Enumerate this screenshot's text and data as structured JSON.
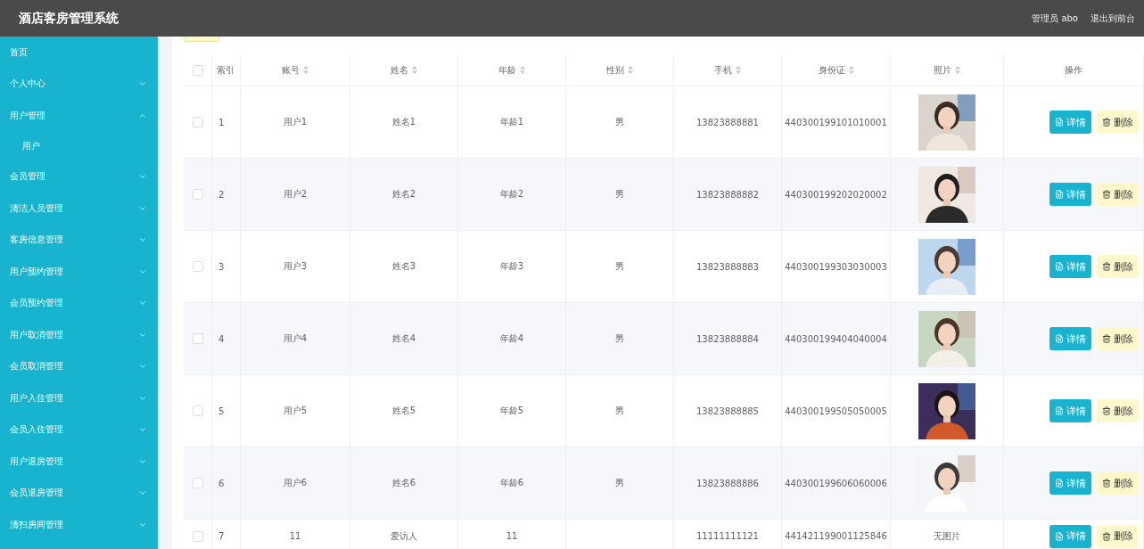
{
  "header": {
    "title": "酒店客房管理系统",
    "user": "管理员 abo",
    "logout": "退出到前台"
  },
  "sidebar": {
    "items": [
      {
        "label": "首页"
      },
      {
        "label": "个人中心",
        "expanded": false
      },
      {
        "label": "用户管理",
        "expanded": true,
        "children": [
          {
            "label": "用户"
          }
        ]
      },
      {
        "label": "会员管理",
        "expanded": false
      },
      {
        "label": "清洁人员管理",
        "expanded": false
      },
      {
        "label": "客房信息管理",
        "expanded": false
      },
      {
        "label": "用户预约管理",
        "expanded": false
      },
      {
        "label": "会员预约管理",
        "expanded": false
      },
      {
        "label": "用户取消管理",
        "expanded": false
      },
      {
        "label": "会员取消管理",
        "expanded": false
      },
      {
        "label": "用户入住管理",
        "expanded": false
      },
      {
        "label": "会员入住管理",
        "expanded": false
      },
      {
        "label": "用户退房管理",
        "expanded": false
      },
      {
        "label": "会员退房管理",
        "expanded": false
      },
      {
        "label": "清扫房间管理",
        "expanded": false
      }
    ]
  },
  "table": {
    "select_all_checked": false,
    "columns": [
      {
        "label": "索引",
        "sortable": false
      },
      {
        "label": "账号",
        "sortable": true
      },
      {
        "label": "姓名",
        "sortable": true
      },
      {
        "label": "年龄",
        "sortable": true
      },
      {
        "label": "性别",
        "sortable": true
      },
      {
        "label": "手机",
        "sortable": true
      },
      {
        "label": "身份证",
        "sortable": true
      },
      {
        "label": "照片",
        "sortable": true
      },
      {
        "label": "操作",
        "sortable": false
      }
    ],
    "rows": [
      {
        "checked": false,
        "index": "1",
        "account": "用户1",
        "name": "姓名1",
        "age": "年龄1",
        "gender": "男",
        "phone": "13823888881",
        "id_card": "440300199101010001",
        "actions": [
          {
            "kind": "detail",
            "label": "详情"
          },
          {
            "kind": "delete",
            "label": "删除"
          }
        ]
      },
      {
        "checked": false,
        "index": "2",
        "account": "用户2",
        "name": "姓名2",
        "age": "年龄2",
        "gender": "男",
        "phone": "13823888882",
        "id_card": "440300199202020002",
        "actions": [
          {
            "kind": "detail",
            "label": "详情"
          },
          {
            "kind": "delete",
            "label": "删除"
          }
        ]
      },
      {
        "checked": false,
        "index": "3",
        "account": "用户3",
        "name": "姓名3",
        "age": "年龄3",
        "gender": "男",
        "phone": "13823888883",
        "id_card": "440300199303030003",
        "actions": [
          {
            "kind": "detail",
            "label": "详情"
          },
          {
            "kind": "delete",
            "label": "删除"
          }
        ]
      },
      {
        "checked": false,
        "index": "4",
        "account": "用户4",
        "name": "姓名4",
        "age": "年龄4",
        "gender": "男",
        "phone": "13823888884",
        "id_card": "440300199404040004",
        "actions": [
          {
            "kind": "detail",
            "label": "详情"
          },
          {
            "kind": "delete",
            "label": "删除"
          }
        ]
      },
      {
        "checked": false,
        "index": "5",
        "account": "用户5",
        "name": "姓名5",
        "age": "年龄5",
        "gender": "男",
        "phone": "13823888885",
        "id_card": "440300199505050005",
        "actions": [
          {
            "kind": "detail",
            "label": "详情"
          },
          {
            "kind": "delete",
            "label": "删除"
          }
        ]
      },
      {
        "checked": false,
        "index": "6",
        "account": "用户6",
        "name": "姓名6",
        "age": "年龄6",
        "gender": "男",
        "phone": "13823888886",
        "id_card": "440300199606060006",
        "actions": [
          {
            "kind": "detail",
            "label": "详情"
          },
          {
            "kind": "delete",
            "label": "删除"
          }
        ]
      },
      {
        "checked": false,
        "index": "7",
        "account": "11",
        "name": "爱访人",
        "age": "11",
        "phone": "11111111121",
        "id_card": "441421199001125846",
        "photo": {
          "kind": "text",
          "text": "无图片"
        },
        "actions": [
          {
            "kind": "detail",
            "label": "详情"
          },
          {
            "kind": "delete",
            "label": "删除"
          }
        ]
      }
    ]
  }
}
